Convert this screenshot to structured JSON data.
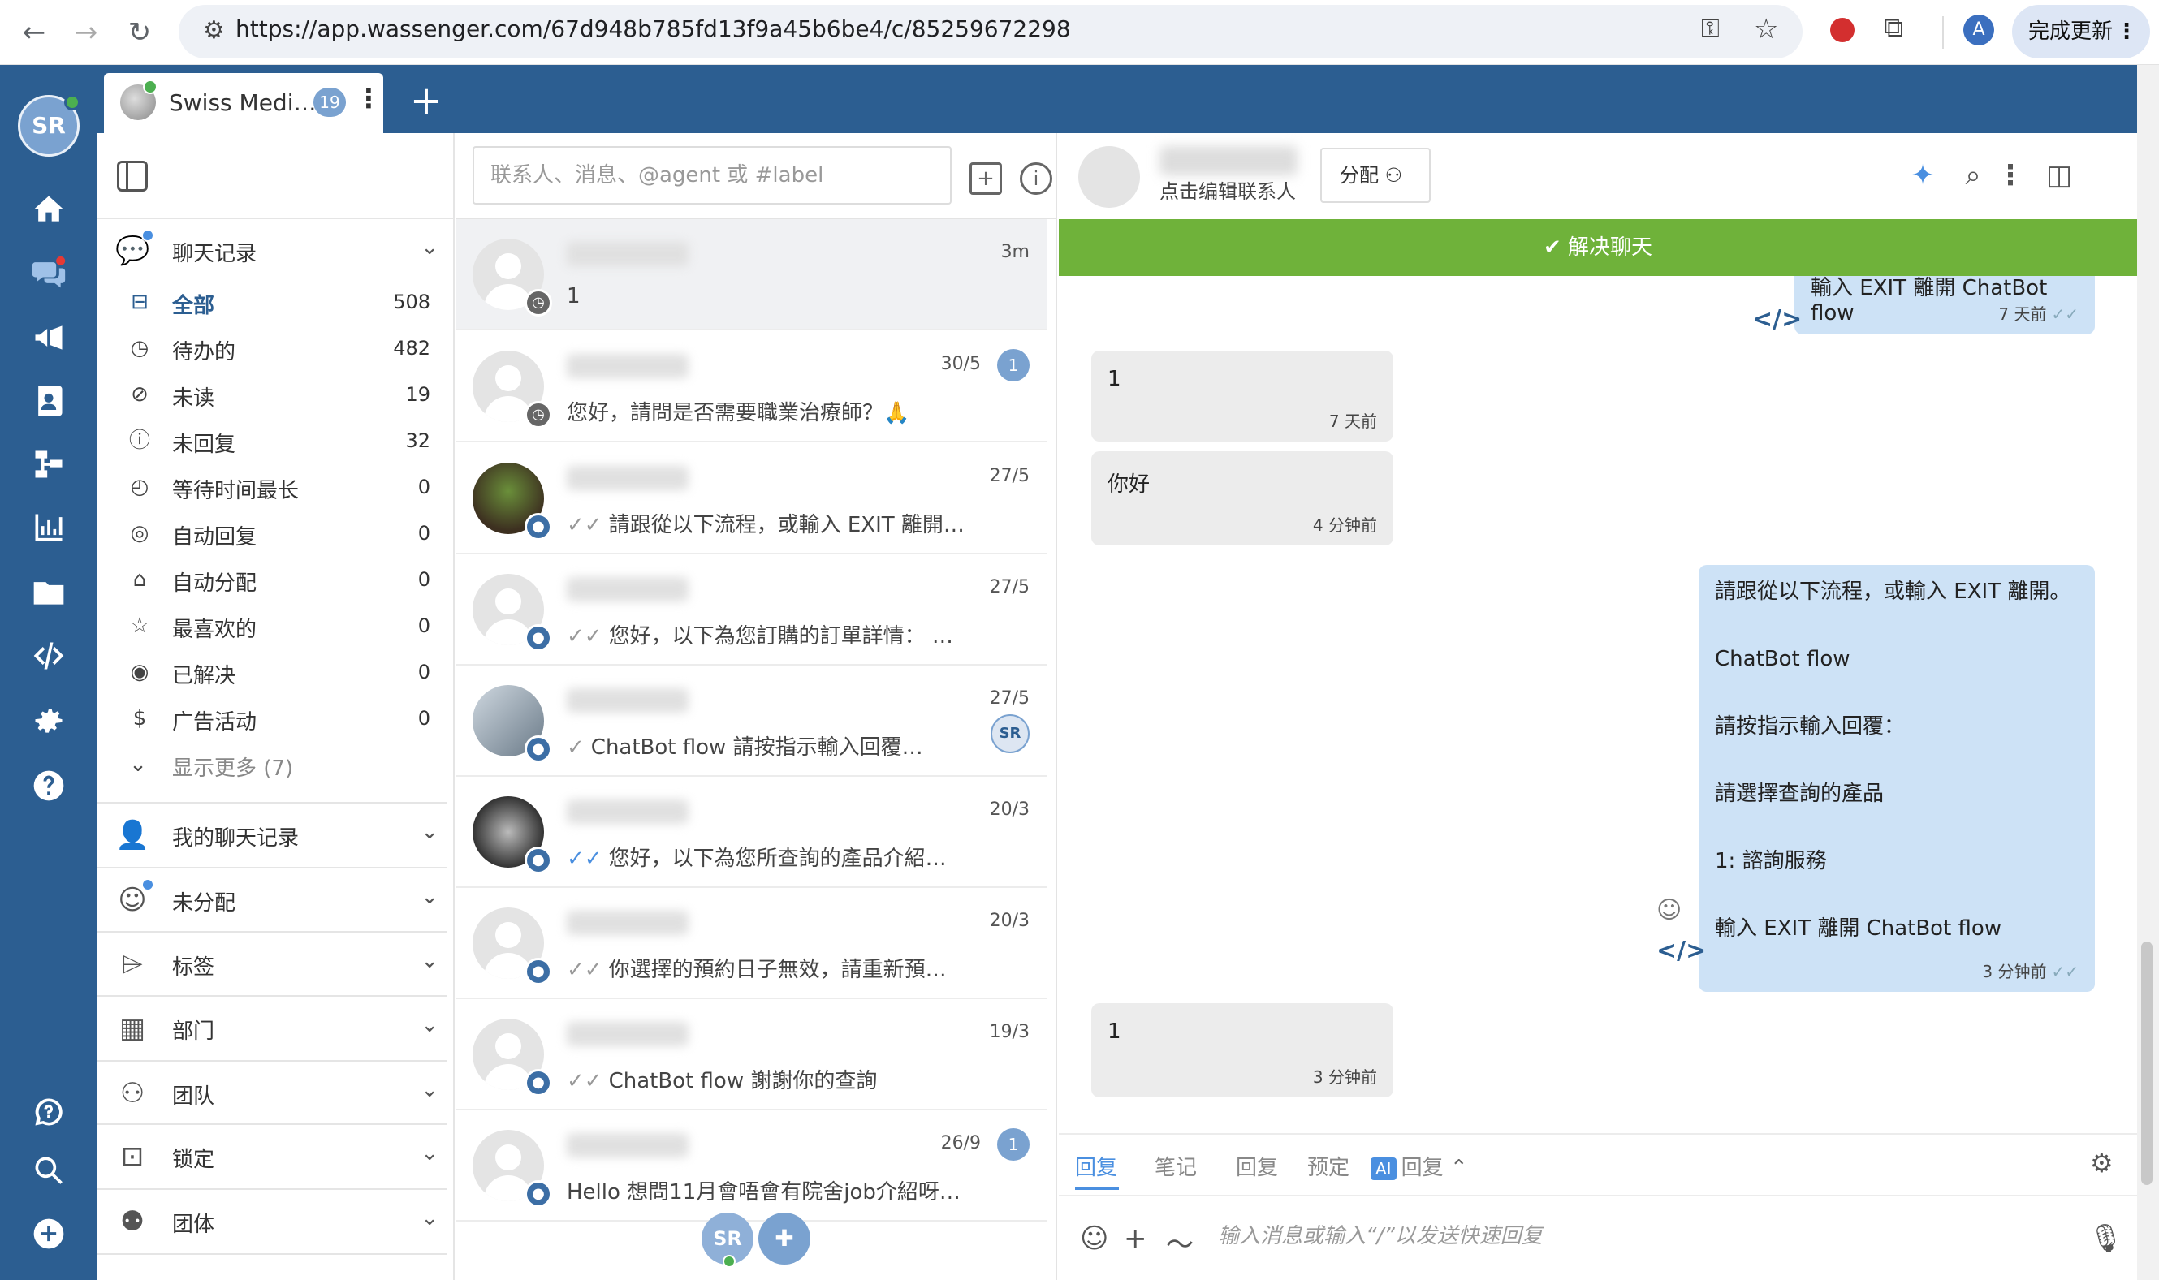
{
  "browser": {
    "url": "https://app.wassenger.com/67d948b785fd13f9a45b6be4/c/85259672298",
    "update_label": "完成更新",
    "profile_initial": "A"
  },
  "app": {
    "user_initials": "SR",
    "workspace_tab": {
      "name": "Swiss Medi…",
      "count": "19"
    }
  },
  "sidebar": {
    "chats_section": "聊天记录",
    "items": [
      {
        "label": "全部",
        "count": "508"
      },
      {
        "label": "待办的",
        "count": "482"
      },
      {
        "label": "未读",
        "count": "19"
      },
      {
        "label": "未回复",
        "count": "32"
      },
      {
        "label": "等待时间最长",
        "count": "0"
      },
      {
        "label": "自动回复",
        "count": "0"
      },
      {
        "label": "自动分配",
        "count": "0"
      },
      {
        "label": "最喜欢的",
        "count": "0"
      },
      {
        "label": "已解决",
        "count": "0"
      },
      {
        "label": "广告活动",
        "count": "0"
      }
    ],
    "show_more": "显示更多 (7)",
    "sections": [
      {
        "label": "我的聊天记录"
      },
      {
        "label": "未分配"
      },
      {
        "label": "标签"
      },
      {
        "label": "部门"
      },
      {
        "label": "团队"
      },
      {
        "label": "锁定"
      },
      {
        "label": "团体"
      }
    ]
  },
  "chatlist": {
    "search_placeholder": "联系人、消息、@agent 或 #label",
    "rows": [
      {
        "time": "3m",
        "preview": "1",
        "tick": ""
      },
      {
        "time": "30/5",
        "preview": "您好，請問是否需要職業治療師？🙏",
        "unread": "1",
        "tick": ""
      },
      {
        "time": "27/5",
        "preview": "請跟從以下流程，或輸入 EXIT 離開。 …",
        "tick": "✓✓"
      },
      {
        "time": "27/5",
        "preview": "您好，以下為您訂購的訂單詳情： 訂…",
        "tick": "✓✓"
      },
      {
        "time": "27/5",
        "preview": "ChatBot flow 請按指示輸入回覆： [Swi…",
        "tick": "✓",
        "agent": "SR"
      },
      {
        "time": "20/3",
        "preview": "您好，以下為您所查詢的產品介紹預…",
        "tick": "✓✓"
      },
      {
        "time": "20/3",
        "preview": "你選擇的預約日子無效，請重新預約。",
        "tick": "✓✓"
      },
      {
        "time": "19/3",
        "preview": "ChatBot flow 謝謝你的查詢",
        "tick": "✓✓"
      },
      {
        "time": "26/9",
        "preview": "Hello 想問11月會唔會有院舍job介紹呀…",
        "unread": "1",
        "tick": ""
      }
    ],
    "footer_initials": "SR"
  },
  "conversation": {
    "edit_contact": "点击编辑联系人",
    "assign_label": "分配",
    "resolve_label": "解决聊天",
    "messages": [
      {
        "dir": "out",
        "text": "輸入 EXIT 離開 ChatBot flow",
        "time": "7 天前"
      },
      {
        "dir": "in",
        "text": "1",
        "time": "7 天前"
      },
      {
        "dir": "in",
        "text": "你好",
        "time": "4 分钟前"
      },
      {
        "dir": "out",
        "lines": [
          "請跟從以下流程，或輸入 EXIT 離開。",
          "ChatBot flow",
          "請按指示輸入回覆：",
          "請選擇查詢的產品",
          "1: 諮詢服務",
          "輸入 EXIT 離開 ChatBot flow"
        ],
        "time": "3 分钟前"
      },
      {
        "dir": "in",
        "text": "1",
        "time": "3 分钟前"
      }
    ],
    "composer_tabs": [
      "回复",
      "笔记",
      "回复",
      "预定",
      "回复"
    ],
    "ai_badge": "AI",
    "composer_placeholder": "输入消息或输入“/”以发送快速回复"
  }
}
